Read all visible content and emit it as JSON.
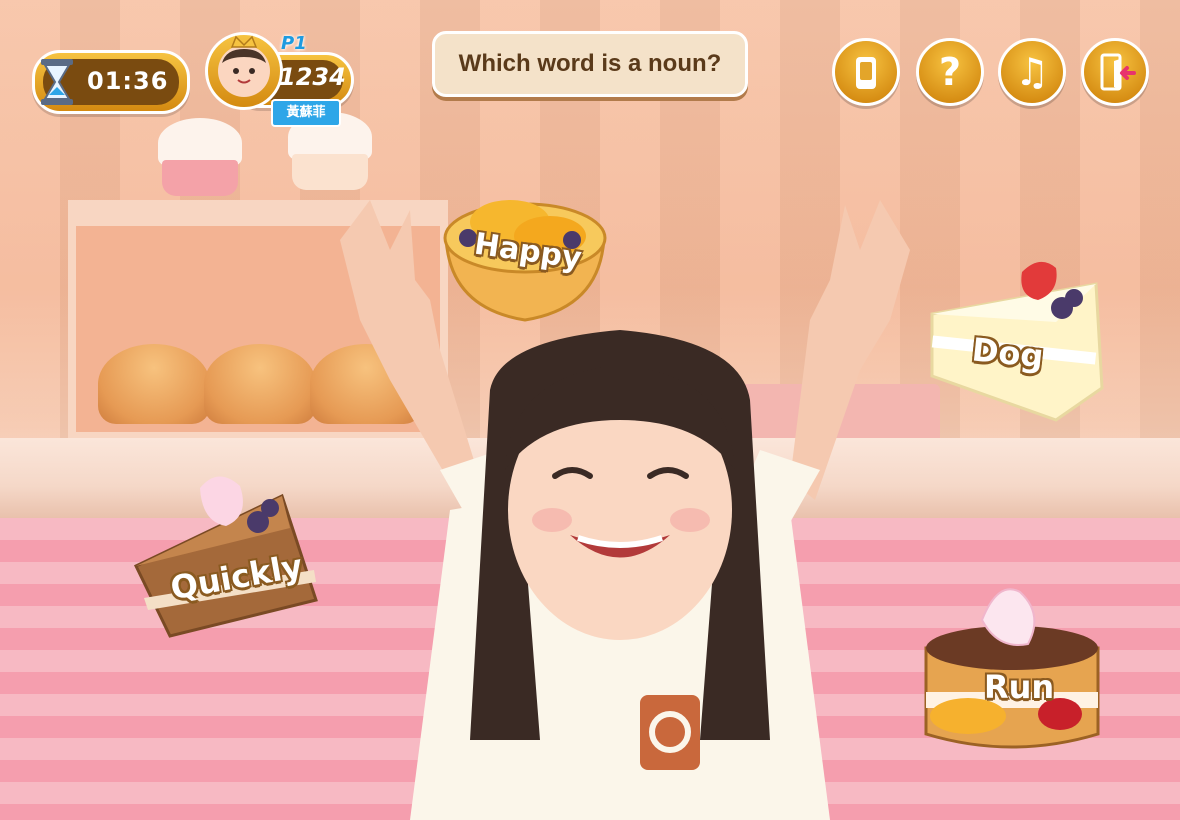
{
  "hud": {
    "timer": "01:36",
    "score": "1234",
    "level": "P1",
    "player_name": "黃蘇菲"
  },
  "question": {
    "text": "Which word is a noun?"
  },
  "answers": [
    {
      "label": "Happy"
    },
    {
      "label": "Dog"
    },
    {
      "label": "Quickly"
    },
    {
      "label": "Run"
    }
  ],
  "buttons": [
    {
      "icon": "phone-icon"
    },
    {
      "icon": "help-icon"
    },
    {
      "icon": "music-icon"
    },
    {
      "icon": "exit-icon"
    }
  ],
  "colors": {
    "button_gold": "#f6c341",
    "name_tag_blue": "#2ea6e8",
    "question_bg": "#f4e2c9"
  }
}
